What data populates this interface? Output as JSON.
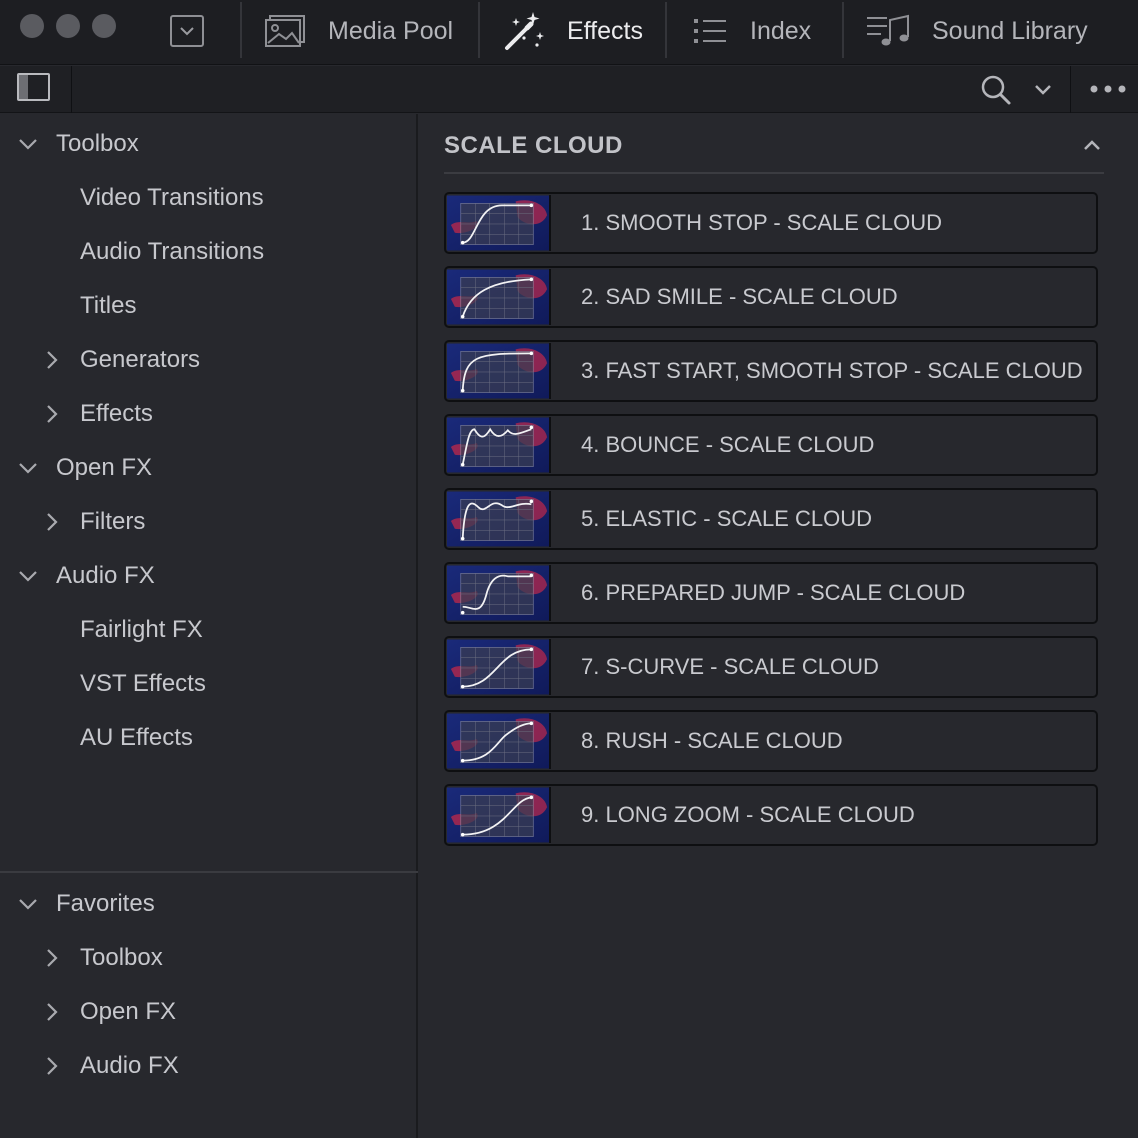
{
  "topbar": {
    "tabs": [
      {
        "label": "Media Pool",
        "icon": "media-pool-icon",
        "active": false
      },
      {
        "label": "Effects",
        "icon": "magic-wand-icon",
        "active": true
      },
      {
        "label": "Index",
        "icon": "list-icon",
        "active": false
      },
      {
        "label": "Sound Library",
        "icon": "music-note-icon",
        "active": false
      }
    ]
  },
  "sidebar": {
    "tree": [
      {
        "label": "Toolbox",
        "level": 0,
        "expander": "down"
      },
      {
        "label": "Video Transitions",
        "level": 1,
        "expander": "none"
      },
      {
        "label": "Audio Transitions",
        "level": 1,
        "expander": "none"
      },
      {
        "label": "Titles",
        "level": 1,
        "expander": "none"
      },
      {
        "label": "Generators",
        "level": 1,
        "expander": "right"
      },
      {
        "label": "Effects",
        "level": 1,
        "expander": "right"
      },
      {
        "label": "Open FX",
        "level": 0,
        "expander": "down"
      },
      {
        "label": "Filters",
        "level": 1,
        "expander": "right"
      },
      {
        "label": "Audio FX",
        "level": 0,
        "expander": "down"
      },
      {
        "label": "Fairlight FX",
        "level": 1,
        "expander": "none"
      },
      {
        "label": "VST Effects",
        "level": 1,
        "expander": "none"
      },
      {
        "label": "AU Effects",
        "level": 1,
        "expander": "none"
      }
    ],
    "favorites": {
      "label": "Favorites",
      "items": [
        {
          "label": "Toolbox"
        },
        {
          "label": "Open FX"
        },
        {
          "label": "Audio FX"
        }
      ]
    }
  },
  "main": {
    "section_title": "SCALE CLOUD",
    "items": [
      {
        "label": "1. SMOOTH STOP - SCALE CLOUD",
        "curve": "smooth-stop"
      },
      {
        "label": "2. SAD SMILE - SCALE CLOUD",
        "curve": "sad-smile"
      },
      {
        "label": "3. FAST START, SMOOTH STOP - SCALE CLOUD",
        "curve": "fast-start"
      },
      {
        "label": "4. BOUNCE - SCALE CLOUD",
        "curve": "bounce"
      },
      {
        "label": "5. ELASTIC - SCALE CLOUD",
        "curve": "elastic"
      },
      {
        "label": "6. PREPARED JUMP - SCALE CLOUD",
        "curve": "prepared-jump"
      },
      {
        "label": "7. S-CURVE - SCALE CLOUD",
        "curve": "s-curve"
      },
      {
        "label": "8. RUSH - SCALE CLOUD",
        "curve": "rush"
      },
      {
        "label": "9. LONG ZOOM - SCALE CLOUD",
        "curve": "long-zoom"
      }
    ]
  },
  "colors": {
    "background": "#27282d",
    "topbar": "#1d1e22",
    "text": "#c9cacf",
    "active_text": "#ececee",
    "thumb_blue": "#1a2a7a",
    "thumb_red": "#c0284a"
  }
}
